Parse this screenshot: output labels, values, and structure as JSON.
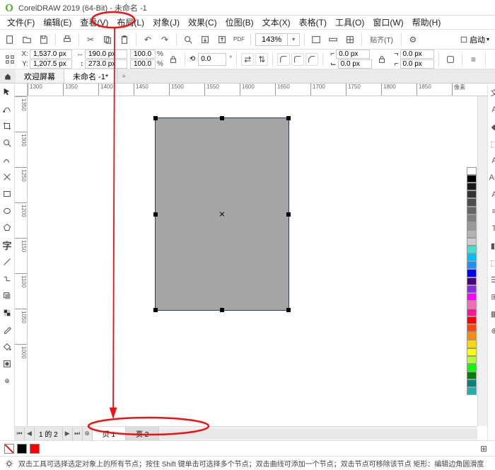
{
  "title": "CorelDRAW 2019 (64-Bit) - 未命名 -1",
  "menus": [
    "文件(F)",
    "编辑(E)",
    "查看(V)",
    "布局(L)",
    "对象(J)",
    "效果(C)",
    "位图(B)",
    "文本(X)",
    "表格(T)",
    "工具(O)",
    "窗口(W)",
    "帮助(H)"
  ],
  "toolbar": {
    "zoom": "143%",
    "paste": "贴齐(T)",
    "launch": "启动"
  },
  "propbar": {
    "x_label": "X:",
    "x": "1,537.0 px",
    "y_label": "Y:",
    "y": "1,207.5 px",
    "w_label": "↔",
    "w": "190.0 px",
    "h_label": "↕",
    "h": "273.0 px",
    "sx": "100.0",
    "sy": "100.0",
    "pct": "%",
    "rot": "0.0",
    "deg": "°",
    "d1": "0.0 px",
    "d2": "0.0 px",
    "d3": "0.0 px",
    "d4": "0.0 px"
  },
  "tabs": {
    "welcome": "欢迎屏幕",
    "doc": "未命名 -1*"
  },
  "ruler_h_ticks": [
    "1300",
    "1350",
    "1400",
    "1450",
    "1500",
    "1550",
    "1600",
    "1650",
    "1700",
    "1750",
    "1800",
    "1850"
  ],
  "ruler_h_unit": "像素",
  "ruler_v_ticks": [
    "1350",
    "1300",
    "1250",
    "1200",
    "1150",
    "1100",
    "1050",
    "1000"
  ],
  "page_nav": {
    "info": "1 的 2"
  },
  "page_tabs": [
    "页 1",
    "页 2"
  ],
  "docker_label": "文",
  "color_swatches": [
    "#ffffff",
    "#000000",
    "#1a1a1a",
    "#333333",
    "#4d4d4d",
    "#666666",
    "#808080",
    "#999999",
    "#b3b3b3",
    "#cccccc",
    "#40e0d0",
    "#00bfff",
    "#1e90ff",
    "#0000ff",
    "#4b0082",
    "#8a2be2",
    "#ff00ff",
    "#ff69b4",
    "#ff1493",
    "#ff0000",
    "#ff4500",
    "#ff8c00",
    "#ffd700",
    "#ffff00",
    "#adff2f",
    "#00ff00",
    "#008000",
    "#008080",
    "#20b2aa"
  ],
  "status_swatches": [
    "#000000",
    "#ff0000"
  ],
  "hint": "双击工具可选择选定对象上的所有节点；按住 Shift 键单击可选择多个节点；双击曲线可添加一个节点；双击节点可移除该节点   矩形：编辑边角圆滑度"
}
